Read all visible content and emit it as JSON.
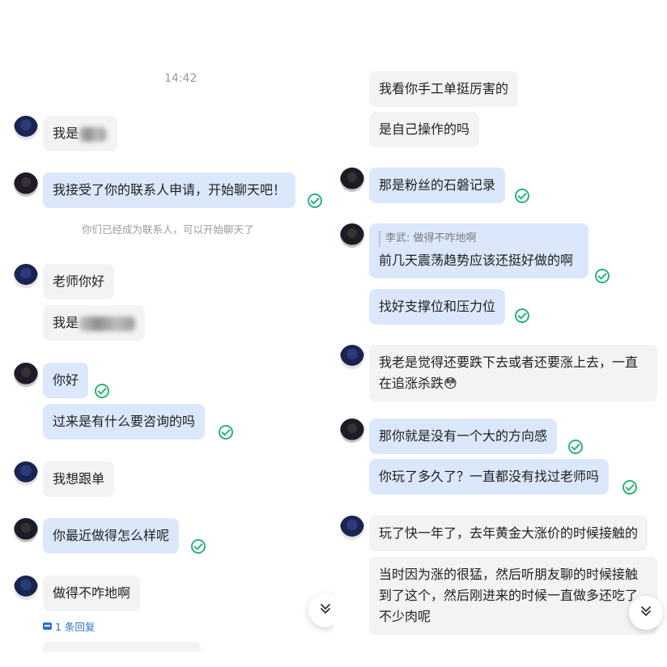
{
  "left": {
    "timestamp": "14:42",
    "messages": [
      {
        "text": "我是"
      },
      {
        "text": "我接受了你的联系人申请，开始聊天吧！"
      },
      {
        "system_note": "你们已经成为联系人，可以开始聊天了"
      },
      {
        "text": "老师你好"
      },
      {
        "text": "我是"
      },
      {
        "text": "你好"
      },
      {
        "text": "过来是有什么要咨询的吗"
      },
      {
        "text": "我想跟单"
      },
      {
        "text": "你最近做得怎么样呢"
      },
      {
        "text": "做得不咋地啊"
      }
    ],
    "reply_count_label": "1 条回复"
  },
  "right": {
    "messages": [
      {
        "text": "我看你手工单挺厉害的"
      },
      {
        "text": "是自己操作的吗"
      },
      {
        "text": "那是粉丝的石磐记录"
      },
      {
        "quote": "李武: 做得不咋地啊",
        "text": "前几天震荡趋势应该还挺好做的啊"
      },
      {
        "text": "找好支撑位和压力位"
      },
      {
        "text": "我老是觉得还要跌下去或者还要涨上去，一直在追涨杀跌😳"
      },
      {
        "text": "那你就是没有一个大的方向感"
      },
      {
        "text": "你玩了多久了？一直都没有找过老师吗"
      },
      {
        "text": "玩了快一年了，去年黄金大涨价的时候接触的"
      },
      {
        "text": "当时因为涨的很猛，然后听朋友聊的时候接触到了这个，然后刚进来的时候一直做多还吃了不少肉呢"
      }
    ]
  },
  "icons": {
    "scroll_down": "chevron-double-down-icon",
    "read_receipt": "check-circle-icon",
    "reply": "reply-comment-icon"
  },
  "colors": {
    "outgoing_bubble": "#dbe8fc",
    "incoming_bubble": "#f3f3f4",
    "read_check": "#2bb37a",
    "link": "#2b6fd6"
  }
}
